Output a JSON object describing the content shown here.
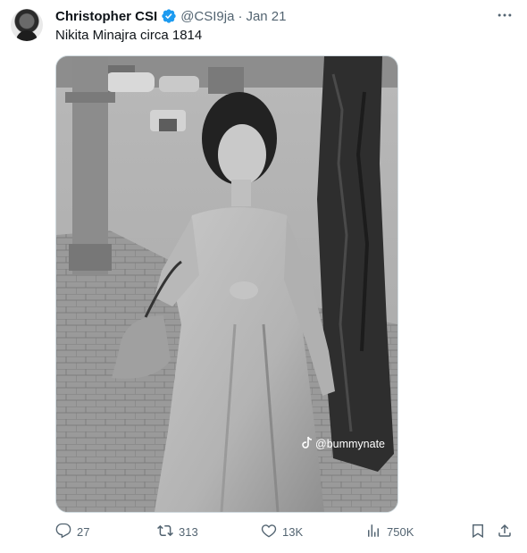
{
  "tweet": {
    "author": "Christopher CSI",
    "handle": "@CSI9ja",
    "separator": "·",
    "date": "Jan 21",
    "text": "Nikita Minajra circa 1814",
    "media": {
      "watermark": "@bummynate"
    },
    "actions": {
      "replies": "27",
      "reposts": "313",
      "likes": "13K",
      "views": "750K"
    }
  },
  "colors": {
    "muted": "#536471",
    "verified": "#1d9bf0",
    "text": "#0f1419"
  },
  "icons": [
    "more-options-icon",
    "verified-badge-icon",
    "reply-icon",
    "repost-icon",
    "like-icon",
    "views-icon",
    "bookmark-icon",
    "share-icon",
    "tiktok-icon"
  ]
}
